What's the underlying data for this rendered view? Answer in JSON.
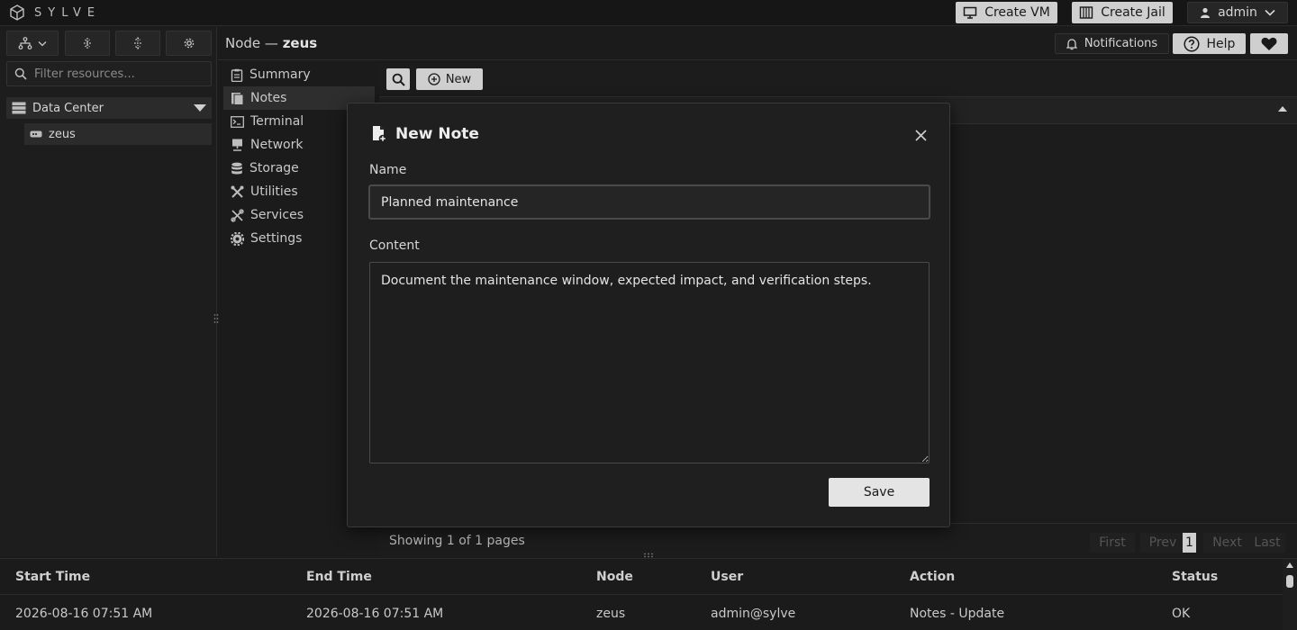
{
  "app": {
    "brand": "SYLVE"
  },
  "topbar": {
    "create_vm_label": "Create VM",
    "create_jail_label": "Create Jail",
    "user_label": "admin"
  },
  "sidebar": {
    "filter_placeholder": "Filter resources...",
    "tree": {
      "datacenter_label": "Data Center",
      "node_label": "zeus"
    }
  },
  "header": {
    "node_prefix": "Node — ",
    "node_name": "zeus",
    "notifications_label": "Notifications",
    "help_label": "Help"
  },
  "nodemenu": {
    "items": [
      {
        "label": "Summary",
        "icon": "clipboard-icon"
      },
      {
        "label": "Notes",
        "icon": "notes-icon"
      },
      {
        "label": "Terminal",
        "icon": "terminal-icon"
      },
      {
        "label": "Network",
        "icon": "network-icon"
      },
      {
        "label": "Storage",
        "icon": "database-icon"
      },
      {
        "label": "Utilities",
        "icon": "tools-icon"
      },
      {
        "label": "Services",
        "icon": "services-icon"
      },
      {
        "label": "Settings",
        "icon": "gear-icon"
      }
    ],
    "active_index": 1
  },
  "content": {
    "new_label": "New",
    "showing_text": "Showing 1 of 1 pages",
    "pager": {
      "first": "First",
      "prev": "Prev",
      "current": "1",
      "next": "Next",
      "last": "Last"
    }
  },
  "modal": {
    "title": "New Note",
    "name_label": "Name",
    "name_value": "Planned maintenance",
    "content_label": "Content",
    "content_value": "Document the maintenance window, expected impact, and verification steps.",
    "save_label": "Save"
  },
  "log": {
    "columns": [
      "Start Time",
      "End Time",
      "Node",
      "User",
      "Action",
      "Status"
    ],
    "rows": [
      [
        "2026-08-16 07:51 AM",
        "2026-08-16 07:51 AM",
        "zeus",
        "admin@sylve",
        "Notes - Update",
        "OK"
      ]
    ]
  },
  "colors": {
    "background": "#1b1b1b",
    "button_light": "#cfcfcf",
    "text": "#d6d6d6"
  }
}
